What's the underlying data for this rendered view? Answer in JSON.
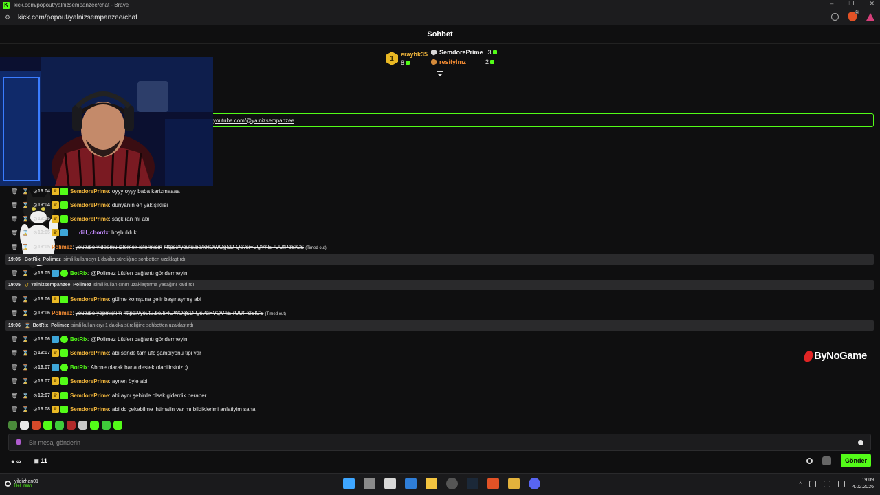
{
  "window": {
    "title": "kick.com/popout/yalnizsempanzee/chat - Brave",
    "url": "kick.com/popout/yalnizsempanzee/chat",
    "win_buttons": [
      "–",
      "❐",
      "✕"
    ]
  },
  "chat": {
    "header_title": "Sohbet",
    "top_gifters": [
      {
        "rank": "1",
        "name": "eraybk35",
        "count": "8"
      },
      {
        "name": "SemdorePrime",
        "count": "3"
      },
      {
        "name": "resitylmz",
        "count": "2"
      }
    ],
    "pinned_text": "youtube.com/@yalnizsempanzee"
  },
  "messages": [
    {
      "time": "19:04",
      "user": "SemdorePrime",
      "text": "oyyy oyyy baba karizmaaaa"
    },
    {
      "time": "19:04",
      "user": "SemdorePrime",
      "text": "dünyanın en yakışıklısı"
    },
    {
      "time": "19:05",
      "user": "SemdorePrime",
      "text": "saçkıran mı abi"
    },
    {
      "time": "19:05",
      "user": "dill_chordx",
      "text": "hoşbulduk"
    },
    {
      "time": "19:05",
      "user": "Polimez",
      "text": "youtube videomu izlemek istermisin",
      "link": "https://youtu.be/kHOWOgSD-Qs?si=VQVhE-rUUfPdSlCS",
      "note": "(Timed out)"
    },
    {
      "time": "19:05",
      "user": "BotRix",
      "text": "@Polimez Lütfen bağlantı göndermeyin."
    },
    {
      "time": "19:06",
      "user": "SemdorePrime",
      "text": "gülme komşuna gelir başınaymış abi"
    },
    {
      "time": "19:06",
      "user": "Polimez",
      "text": "youtube yapmıştım",
      "link": "https://youtu.be/kHOWOgSD-Qs?si=VQVhE-rUUfPdSlCS",
      "note": "(Timed out)"
    },
    {
      "time": "19:06",
      "user": "BotRix",
      "text": "@Polimez Lütfen bağlantı göndermeyin."
    },
    {
      "time": "19:07",
      "user": "SemdorePrime",
      "text": "abi sende tam ufc şampiyonu tipi var"
    },
    {
      "time": "19:07",
      "user": "BotRix",
      "text": "Abone olarak bana destek olabilirsiniz ;)"
    },
    {
      "time": "19:07",
      "user": "SemdorePrime",
      "text": "aynen öyle abi"
    },
    {
      "time": "19:07",
      "user": "SemdorePrime",
      "text": "abi aynı şehirde olsak giderdik beraber"
    },
    {
      "time": "19:08",
      "user": "SemdorePrime",
      "text": "abi dc çekebilme ihtimalin var mı bildiklerimi anlatiyim sana"
    }
  ],
  "system_messages": [
    {
      "time": "19:05",
      "actor": "BotRix",
      "target": "Polimez",
      "text": "isimli kullanıcıyı 1 dakika süreliğine sohbetten uzaklaştırdı"
    },
    {
      "time": "19:05",
      "actor": "Yalnizsempanzee",
      "target": "Polimez",
      "text": "isimli kullanıcının uzaklaştırma yasağını kaldırdı"
    },
    {
      "time": "19:06",
      "actor": "BotRix",
      "target": "Polimez",
      "text": "isimli kullanıcıyı 1 dakika süreliğine sohbetten uzaklaştırdı"
    }
  ],
  "watermark": "ByNoGame",
  "input": {
    "placeholder": "Bir mesaj gönderin",
    "send_label": "Gönder"
  },
  "bottom": {
    "infinity": "∞",
    "gift_count": "11"
  },
  "taskbar": {
    "user": "yildizhan01",
    "user_sub": "Hell Yeah",
    "time": "19:09",
    "date": "4.02.2026"
  },
  "colors": {
    "accent": "#53fc18",
    "semdore": "#f2b63c",
    "botrix": "#53fc18",
    "polimez": "#f28b33",
    "dill": "#c48cff"
  }
}
